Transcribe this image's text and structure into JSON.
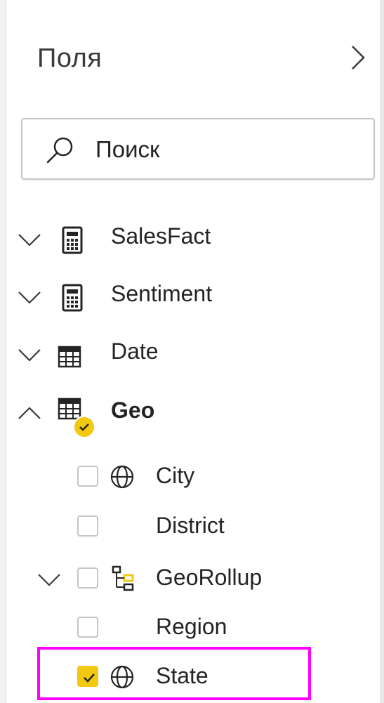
{
  "pane": {
    "title": "Поля",
    "collapse_icon": "chevron-right-icon"
  },
  "search": {
    "placeholder": "Поиск",
    "icon": "search-icon"
  },
  "tables": [
    {
      "name": "SalesFact",
      "icon": "calculator-table-icon",
      "expanded": false
    },
    {
      "name": "Sentiment",
      "icon": "calculator-table-icon",
      "expanded": false
    },
    {
      "name": "Date",
      "icon": "table-icon",
      "expanded": false
    },
    {
      "name": "Geo",
      "icon": "table-icon",
      "expanded": true,
      "has_selection": true
    }
  ],
  "geo_fields": [
    {
      "name": "City",
      "icon": "globe-icon",
      "checked": false
    },
    {
      "name": "District",
      "icon": "",
      "checked": false
    },
    {
      "name": "GeoRollup",
      "icon": "hierarchy-icon",
      "checked": false,
      "expandable": true
    },
    {
      "name": "Region",
      "icon": "",
      "checked": false
    },
    {
      "name": "State",
      "icon": "globe-icon",
      "checked": true,
      "highlighted": true
    }
  ],
  "colors": {
    "accent_yellow": "#f2c811",
    "highlight_magenta": "#ff00ff",
    "text": "#252423",
    "border": "#c8c6c4"
  }
}
